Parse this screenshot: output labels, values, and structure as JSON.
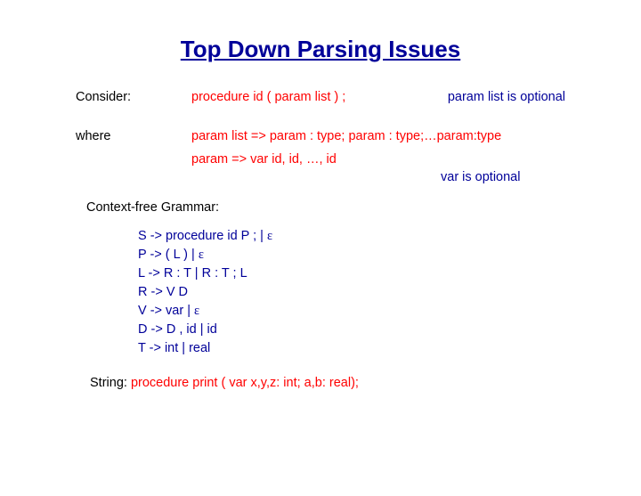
{
  "title": "Top Down Parsing Issues",
  "consider": {
    "label": "Consider:",
    "code": "procedure id ( param list ) ;",
    "note": "param list is optional"
  },
  "where": {
    "label": "where",
    "line1": "param list => param : type; param : type;…param:type",
    "line2": "param => var id, id, …, id",
    "note": "var is optional"
  },
  "cfg_label": "Context-free Grammar:",
  "grammar": {
    "l1a": "S -> procedure id P ; | ",
    "l1eps": "ε",
    "l2a": "P -> ( L ) | ",
    "l2eps": "ε",
    "l3": "L -> R : T | R : T ; L",
    "l4": "R -> V D",
    "l5a": "V -> var | ",
    "l5eps": "ε",
    "l6": "D -> D , id | id",
    "l7": "T -> int | real"
  },
  "string": {
    "label": "String: ",
    "code": "procedure print ( var x,y,z: int; a,b: real);"
  }
}
